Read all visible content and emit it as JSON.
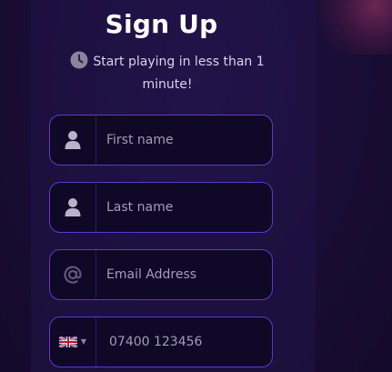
{
  "header": {
    "title": "Sign Up",
    "subtitle": "Start playing in less than 1 minute!"
  },
  "form": {
    "first_name": {
      "placeholder": "First name",
      "value": ""
    },
    "last_name": {
      "placeholder": "Last name",
      "value": ""
    },
    "email": {
      "placeholder": "Email Address",
      "value": ""
    },
    "phone": {
      "placeholder": "07400 123456",
      "value": "",
      "country_flag": "uk-flag-icon"
    }
  },
  "icons": {
    "subtitle": "clock-icon",
    "first_name": "user-icon",
    "last_name": "user-icon",
    "email": "at-icon",
    "phone_country": "uk-flag-icon"
  },
  "colors": {
    "background": "#140a2a",
    "panel": "#201448",
    "field_border": "#5b3bc4",
    "field_bg": "#0f0826",
    "title": "#ffffff",
    "placeholder": "#a39db8"
  }
}
